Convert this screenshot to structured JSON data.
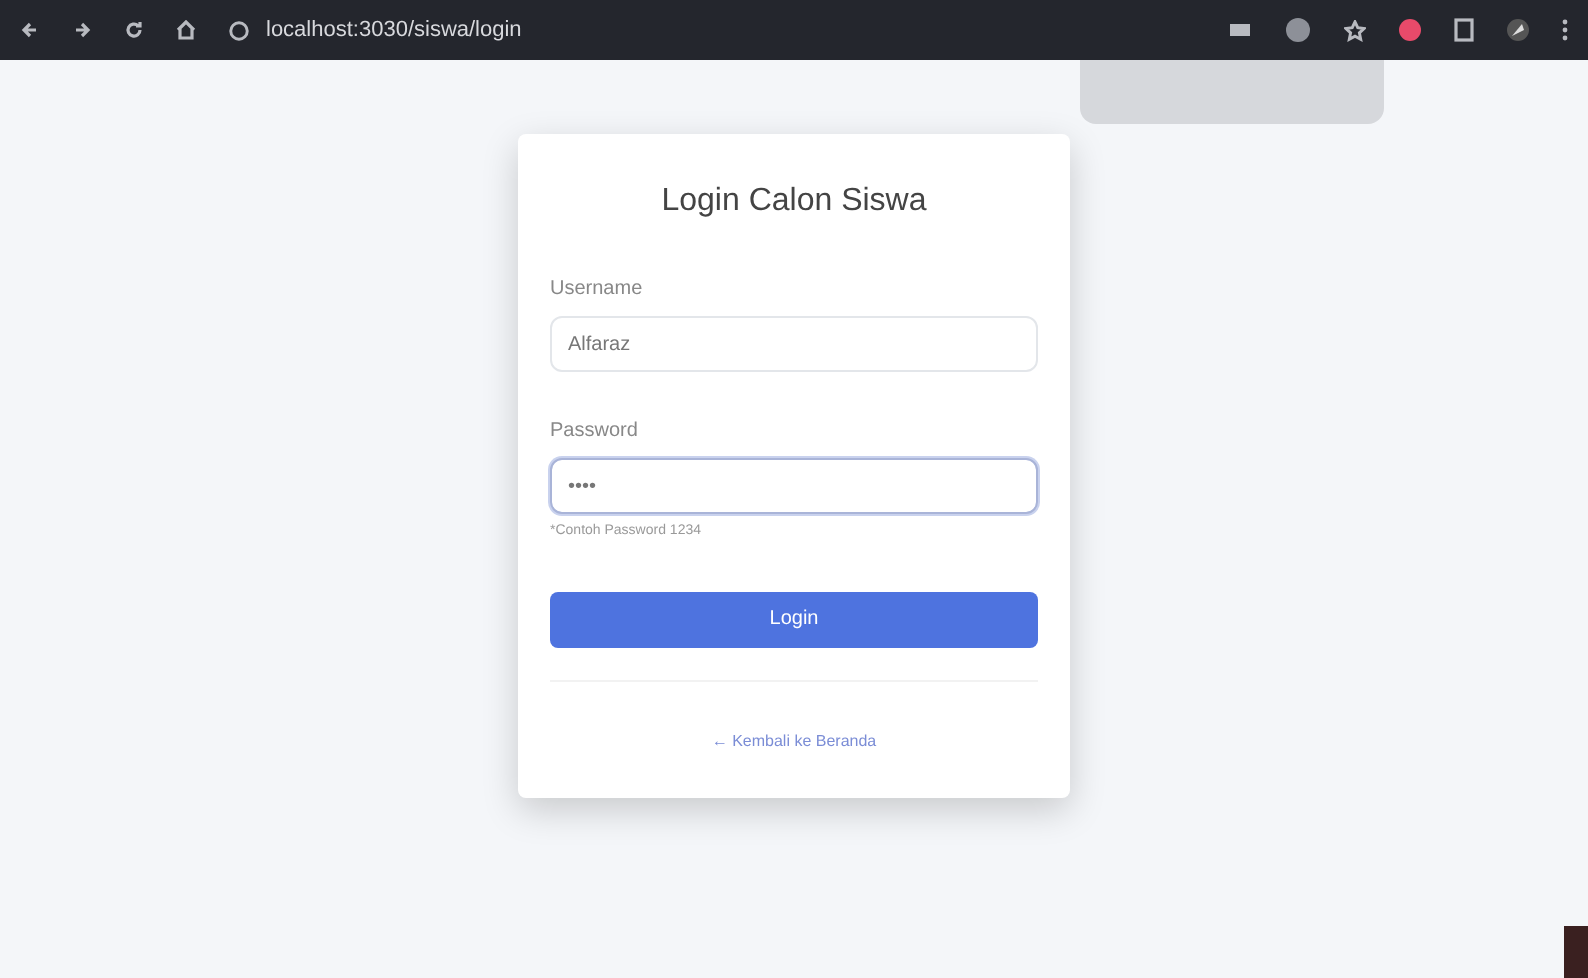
{
  "browser": {
    "url": "localhost:3030/siswa/login"
  },
  "login_card": {
    "title": "Login Calon Siswa",
    "fields": [
      {
        "label": "Username",
        "value": "Alfaraz",
        "focused": false
      },
      {
        "label": "Password",
        "value": "••••",
        "focused": true
      }
    ],
    "hint": "*Contoh Password 1234",
    "button": "Login",
    "back_link": "← Kembali ke Beranda"
  }
}
